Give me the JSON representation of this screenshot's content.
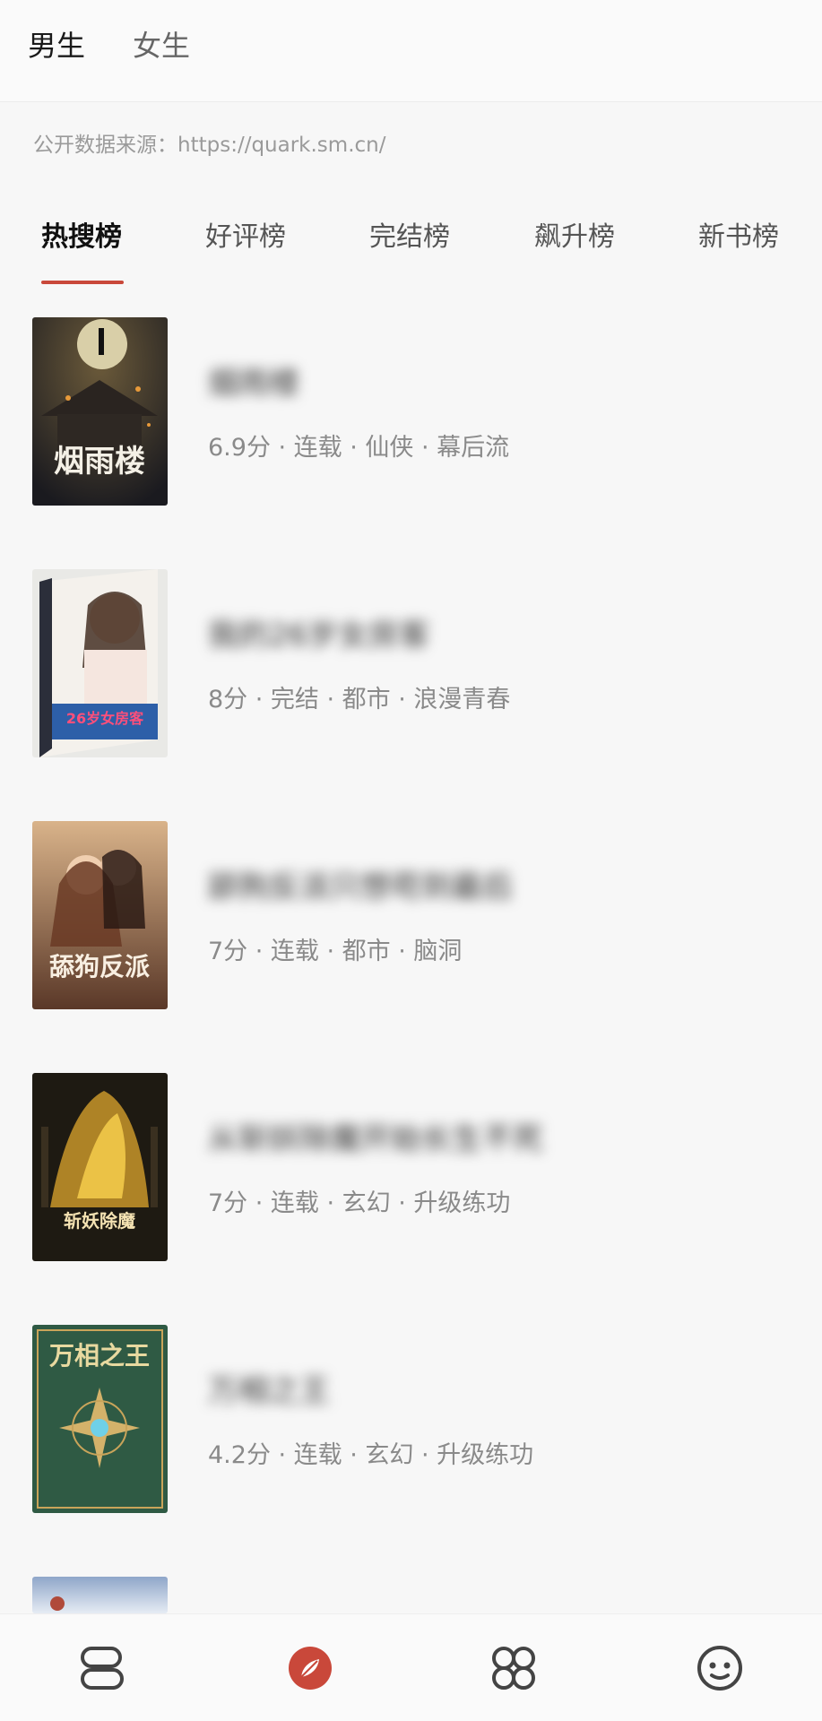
{
  "gender_tabs": {
    "male": "男生",
    "female": "女生"
  },
  "source_note": "公开数据来源：https://quark.sm.cn/",
  "rank_tabs": [
    "热搜榜",
    "好评榜",
    "完结榜",
    "飙升榜",
    "新书榜"
  ],
  "books": [
    {
      "title": "烟雨楼",
      "meta": "6.9分 · 连载 · 仙侠 · 幕后流",
      "cover_text": "烟雨楼"
    },
    {
      "title": "我的26岁女房客",
      "meta": "8分 · 完结 · 都市 · 浪漫青春",
      "cover_text": "26岁女房客"
    },
    {
      "title": "舔狗反派只想苟到最后",
      "meta": "7分 · 连载 · 都市 · 脑洞",
      "cover_text": "舔狗反派"
    },
    {
      "title": "从斩妖除魔开始长生不死",
      "meta": "7分 · 连载 · 玄幻 · 升级练功",
      "cover_text": "斩妖除魔"
    },
    {
      "title": "万相之王",
      "meta": "4.2分 · 连载 · 玄幻 · 升级练功",
      "cover_text": "万相之王"
    }
  ],
  "colors": {
    "accent": "#c9483a",
    "text": "#222222",
    "meta": "#8a8a8a"
  },
  "nav_icons": [
    "bookshelf-icon",
    "discover-icon",
    "category-icon",
    "profile-icon"
  ]
}
